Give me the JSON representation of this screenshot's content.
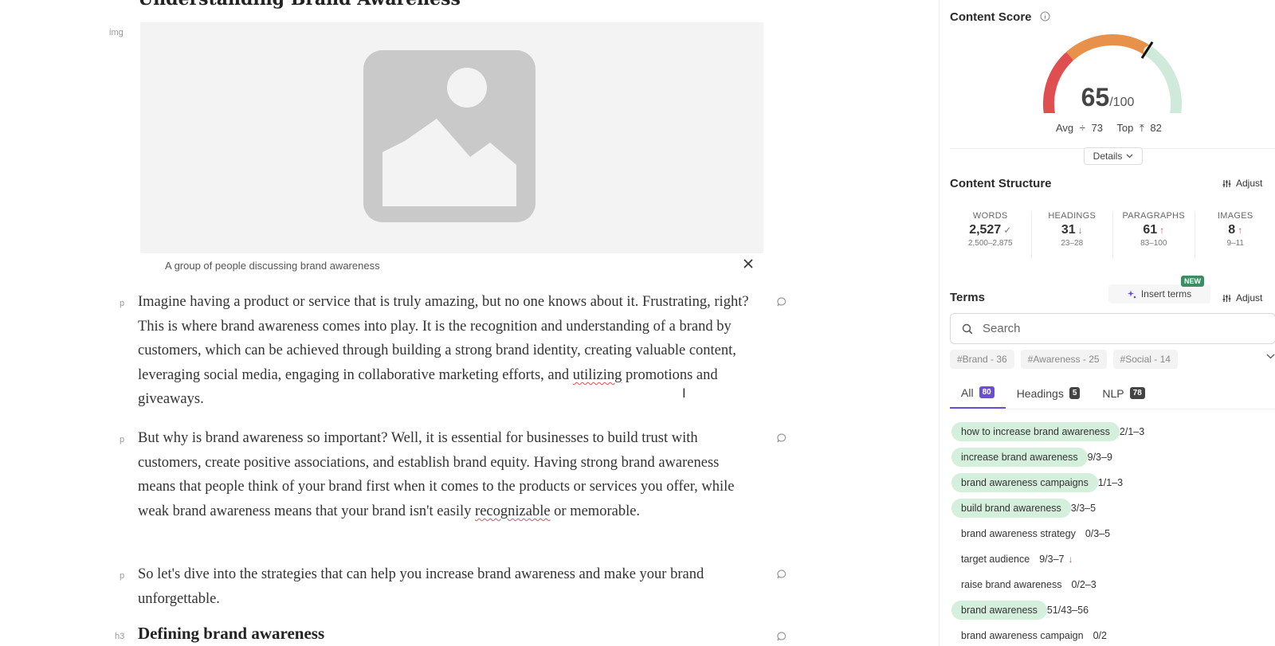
{
  "editor": {
    "h2": {
      "tag": "",
      "text": "Understanding Brand Awareness"
    },
    "image_tag": "img",
    "caption": "A group of people discussing brand awareness",
    "paragraph_tag": "p",
    "paragraphs": [
      {
        "segments": [
          "Imagine having a product or service that is truly amazing, but no one knows about it. Frustrating, right? This is where brand awareness comes into play. It is the recognition and understanding of a brand by customers, which can be achieved through building a strong brand identity, creating valuable content, leveraging social media, engaging in collaborative marketing efforts, and ",
          "utilizing",
          " promotions and giveaways."
        ]
      },
      {
        "segments": [
          "But why is brand awareness so important? Well, it is essential for businesses to build trust with customers, create positive associations, and establish brand equity. Having strong brand awareness means that people think of your brand first when it comes to the products or services you offer, while weak brand awareness means that your brand isn't easily ",
          "recognizable",
          " or memorable."
        ]
      },
      {
        "segments": [
          "So let's dive into the strategies that can help you increase brand awareness and make your brand unforgettable."
        ]
      }
    ],
    "h3": {
      "tag": "h3",
      "text": "Defining brand awareness"
    }
  },
  "sidebar": {
    "content_score": {
      "title": "Content Score",
      "score": "65",
      "out_of": "/100",
      "score_value": 65,
      "avg_label": "Avg",
      "avg_value": "73",
      "top_label": "Top",
      "top_value": "82",
      "details_label": "Details",
      "gauge_colors": {
        "low": "#e04f4f",
        "mid": "#e8914a",
        "high": "#cfeadb",
        "needle": "#111111"
      }
    },
    "content_structure": {
      "title": "Content Structure",
      "adjust_label": "Adjust",
      "metrics": [
        {
          "label": "WORDS",
          "value": "2,527",
          "indicator": "✓",
          "indicator_color": "#7a7a7a",
          "range": "2,500–2,875"
        },
        {
          "label": "HEADINGS",
          "value": "31",
          "indicator": "↓",
          "indicator_color": "#d9534f",
          "range": "23–28"
        },
        {
          "label": "PARAGRAPHS",
          "value": "61",
          "indicator": "↑",
          "indicator_color": "#d9534f",
          "range": "83–100"
        },
        {
          "label": "IMAGES",
          "value": "8",
          "indicator": "↑",
          "indicator_color": "#d9534f",
          "range": "9–11"
        }
      ]
    },
    "terms": {
      "title": "Terms",
      "insert_label": "Insert terms",
      "new_badge": "NEW",
      "adjust_label": "Adjust",
      "search_placeholder": "Search",
      "hashtags": [
        "#Brand - 36",
        "#Awareness - 25",
        "#Social - 14"
      ],
      "tabs": [
        {
          "label": "All",
          "count": "80",
          "count_color": "#6a4fd6",
          "active": true
        },
        {
          "label": "Headings",
          "count": "5",
          "count_color": "#444444",
          "active": false
        },
        {
          "label": "NLP",
          "count": "78",
          "count_color": "#444444",
          "active": false
        }
      ],
      "items": [
        {
          "term": "how to increase brand awareness",
          "count": "2/1–3",
          "done": true,
          "over": false
        },
        {
          "term": "increase brand awareness",
          "count": "9/3–9",
          "done": true,
          "over": false
        },
        {
          "term": "brand awareness campaigns",
          "count": "1/1–3",
          "done": true,
          "over": false
        },
        {
          "term": "build brand awareness",
          "count": "3/3–5",
          "done": true,
          "over": false
        },
        {
          "term": "brand awareness strategy",
          "count": "0/3–5",
          "done": false,
          "over": false
        },
        {
          "term": "target audience",
          "count": "9/3–7",
          "done": false,
          "over": true
        },
        {
          "term": "raise brand awareness",
          "count": "0/2–3",
          "done": false,
          "over": false
        },
        {
          "term": "brand awareness",
          "count": "51/43–56",
          "done": true,
          "over": false
        },
        {
          "term": "brand awareness campaign",
          "count": "0/2",
          "done": false,
          "over": false
        }
      ]
    }
  }
}
